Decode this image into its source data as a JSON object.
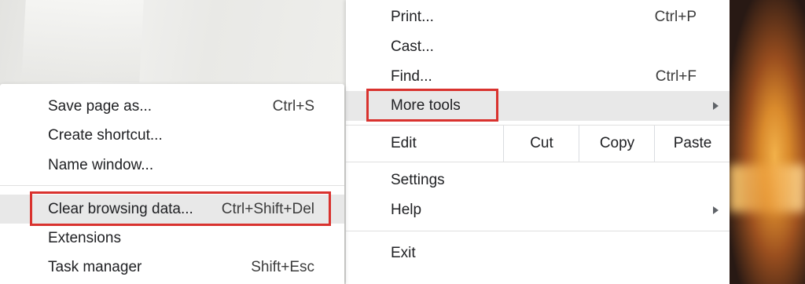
{
  "main_menu": {
    "print": {
      "label": "Print...",
      "shortcut": "Ctrl+P"
    },
    "cast": {
      "label": "Cast..."
    },
    "find": {
      "label": "Find...",
      "shortcut": "Ctrl+F"
    },
    "more_tools": {
      "label": "More tools"
    },
    "edit": {
      "label": "Edit",
      "cut": "Cut",
      "copy": "Copy",
      "paste": "Paste"
    },
    "settings": {
      "label": "Settings"
    },
    "help": {
      "label": "Help"
    },
    "exit": {
      "label": "Exit"
    }
  },
  "more_tools_submenu": {
    "save_page": {
      "label": "Save page as...",
      "shortcut": "Ctrl+S"
    },
    "create_shortcut": {
      "label": "Create shortcut..."
    },
    "name_window": {
      "label": "Name window..."
    },
    "clear_browsing": {
      "label": "Clear browsing data...",
      "shortcut": "Ctrl+Shift+Del"
    },
    "extensions": {
      "label": "Extensions"
    },
    "task_manager": {
      "label": "Task manager",
      "shortcut": "Shift+Esc"
    }
  },
  "colors": {
    "highlight_box": "#d9322e",
    "hover_bg": "#e8e8e8",
    "menu_bg": "#ffffff"
  },
  "icons": [
    "submenu-arrow-icon"
  ]
}
